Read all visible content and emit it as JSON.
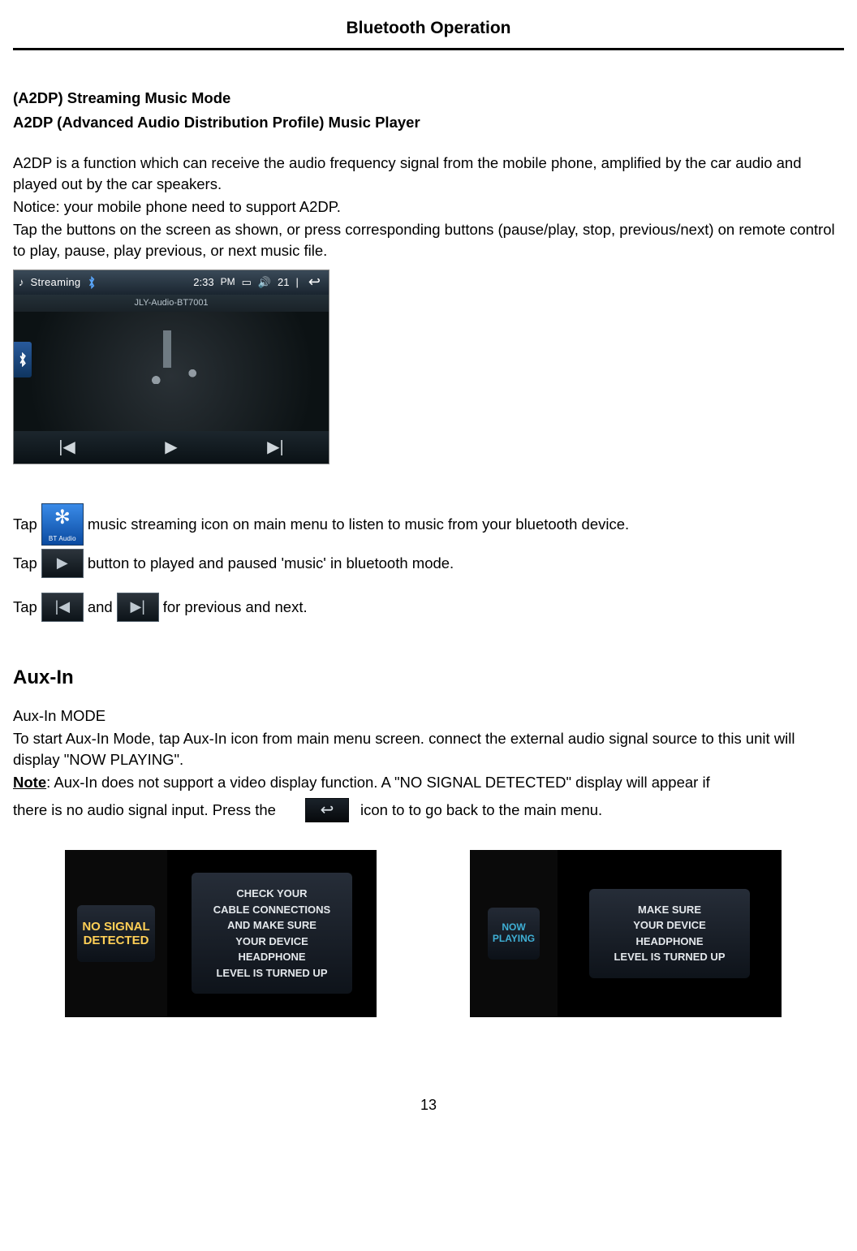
{
  "header": {
    "title": "Bluetooth Operation"
  },
  "sec1": {
    "title": "(A2DP) Streaming Music Mode",
    "subtitle": "A2DP (Advanced Audio Distribution Profile) Music Player",
    "p1": "A2DP is a function which can receive the audio frequency signal from the mobile phone, amplified by the car audio and played out by the car speakers.",
    "p2": "Notice: your mobile phone need to support A2DP.",
    "p3": "Tap the buttons on the screen as shown, or press corresponding buttons (pause/play, stop, previous/next) on remote control to play, pause, play previous, or next music file."
  },
  "stream_shot": {
    "title": "Streaming",
    "time": "2:33",
    "ampm": "PM",
    "vol": "21",
    "device": "JLY-Audio-BT7001"
  },
  "instructions": {
    "bt_audio_caption": "BT Audio",
    "tap_word": "Tap ",
    "l1_after": "music streaming icon on main menu to listen to music from your bluetooth device.",
    "l2_after": " button to played and paused 'music' in bluetooth mode.",
    "l3_mid": "and ",
    "l3_after": " for previous and next."
  },
  "auxin": {
    "heading": "Aux-In",
    "mode": "Aux-In MODE",
    "p1": "To start Aux-In Mode, tap Aux-In icon from main menu screen. connect the external audio signal source to this unit will display \"NOW PLAYING\".",
    "note_label": "Note",
    "note_rest_a": ": Aux-In does not support a video display function. A \"NO SIGNAL DETECTED\" display will appear if",
    "note_rest_b": "there is no audio signal input. Press the",
    "note_rest_c": "icon to to go back to the main menu."
  },
  "aux_shots": {
    "left_side_l1": "NO SIGNAL",
    "left_side_l2": "DETECTED",
    "left_msg": "CHECK YOUR\nCABLE CONNECTIONS\nAND MAKE SURE\nYOUR DEVICE\nHEADPHONE\nLEVEL IS TURNED UP",
    "right_side_l1": "NOW",
    "right_side_l2": "PLAYING",
    "right_msg": "MAKE SURE\nYOUR DEVICE\nHEADPHONE\nLEVEL IS TURNED UP"
  },
  "page_number": "13"
}
